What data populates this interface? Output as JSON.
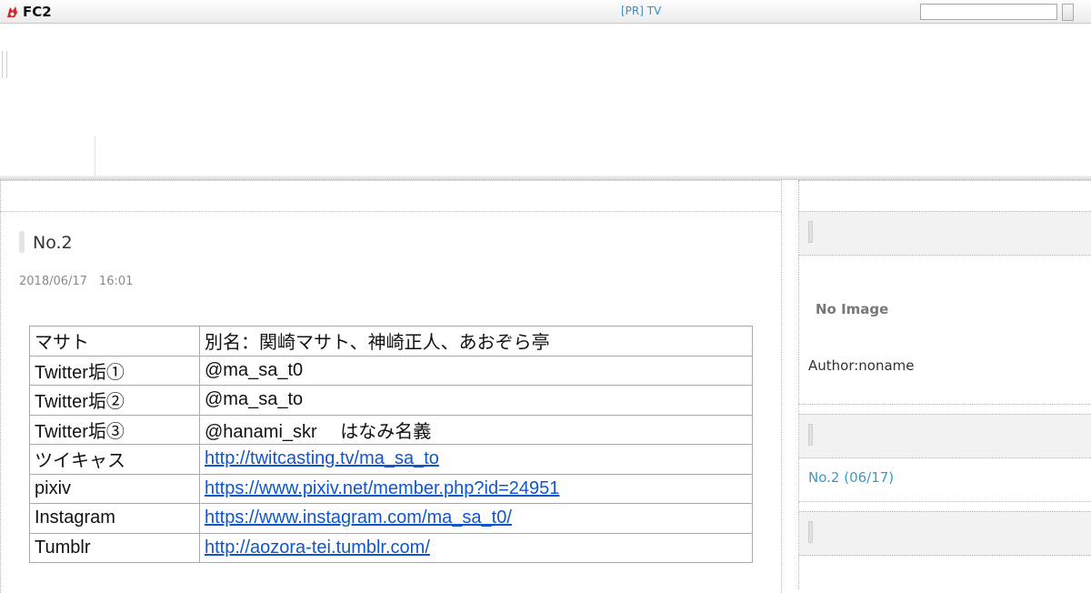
{
  "topbar": {
    "logo_text": "FC2",
    "pr_link": "[PR] TV",
    "search": {
      "value": "",
      "placeholder": ""
    }
  },
  "entry": {
    "title": "No.2",
    "date": "2018/06/17　16:01"
  },
  "profile_table": [
    {
      "key": "マサト",
      "value": "別名：関崎マサト、神崎正人、あおぞら亭",
      "link": false
    },
    {
      "key": "Twitter垢①",
      "value": "@ma_sa_t0",
      "link": false
    },
    {
      "key": "Twitter垢②",
      "value": "@ma_sa_to",
      "link": false
    },
    {
      "key": "Twitter垢③",
      "value": "@hanami_skr　 はなみ名義",
      "link": false
    },
    {
      "key": "ツイキャス",
      "value": "http://twitcasting.tv/ma_sa_to",
      "link": true
    },
    {
      "key": "pixiv",
      "value": "https://www.pixiv.net/member.php?id=24951",
      "link": true
    },
    {
      "key": "Instagram",
      "value": "https://www.instagram.com/ma_sa_t0/",
      "link": true
    },
    {
      "key": "Tumblr",
      "value": "http://aozora-tei.tumblr.com/",
      "link": true
    }
  ],
  "sidebar": {
    "profile": {
      "no_image": "No Image",
      "author": "Author:noname"
    },
    "recent_entries": [
      {
        "label": "No.2 (06/17)"
      }
    ]
  },
  "colors": {
    "link": "#1155cc",
    "accent_link": "#3a9ac7",
    "pr_link": "#3a8fc4"
  }
}
